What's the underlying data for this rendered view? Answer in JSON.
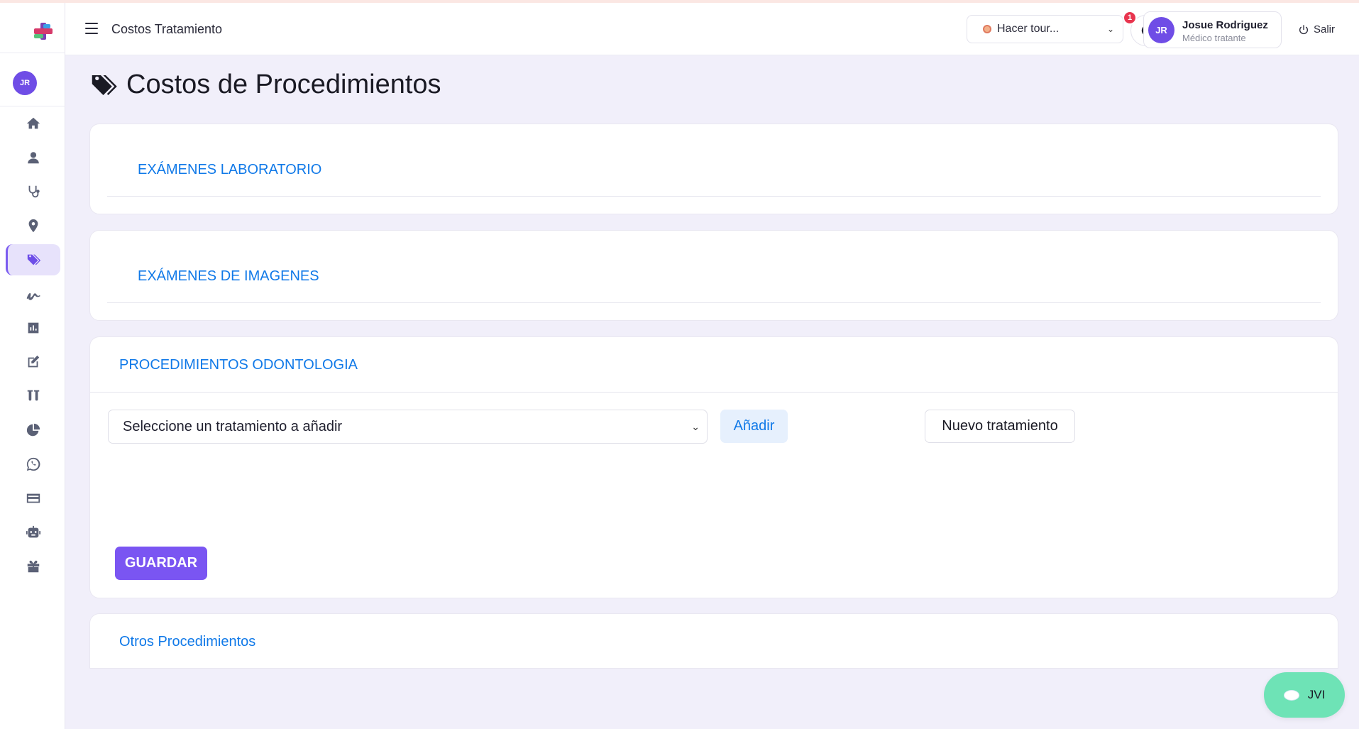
{
  "header": {
    "page_heading": "Costos Tratamiento",
    "tour_select": "Hacer tour...",
    "notification_count": "1",
    "user": {
      "initials": "JR",
      "name": "Josue Rodriguez",
      "role": "Médico tratante"
    },
    "logout_label": "Salir"
  },
  "sidebar": {
    "avatar_initials": "JR",
    "items": [
      {
        "icon": "home-icon",
        "active": false
      },
      {
        "icon": "user-icon",
        "active": false
      },
      {
        "icon": "stethoscope-icon",
        "active": false
      },
      {
        "icon": "map-pin-icon",
        "active": false
      },
      {
        "icon": "tags-icon",
        "active": true
      },
      {
        "icon": "signature-icon",
        "active": false
      },
      {
        "icon": "chart-bar-icon",
        "active": false
      },
      {
        "icon": "edit-icon",
        "active": false
      },
      {
        "icon": "test-tubes-icon",
        "active": false
      },
      {
        "icon": "pie-chart-icon",
        "active": false
      },
      {
        "icon": "whatsapp-icon",
        "active": false
      },
      {
        "icon": "credit-card-icon",
        "active": false
      },
      {
        "icon": "robot-icon",
        "active": false
      },
      {
        "icon": "gift-icon",
        "active": false
      }
    ]
  },
  "main": {
    "title": "Costos de Procedimientos",
    "sections": {
      "lab": "EXÁMENES LABORATORIO",
      "imaging": "EXÁMENES DE IMAGENES",
      "odonto": "PROCEDIMIENTOS ODONTOLOGIA",
      "other": "Otros Procedimientos"
    },
    "odonto_form": {
      "select_value": "Seleccione un tratamiento a añadir",
      "add_label": "Añadir",
      "new_label": "Nuevo tratamiento",
      "save_label": "GUARDAR"
    }
  },
  "chat": {
    "label": "JVI"
  },
  "colors": {
    "accent": "#7a55f2",
    "link": "#1079e8",
    "chat": "#6ee3b6"
  }
}
